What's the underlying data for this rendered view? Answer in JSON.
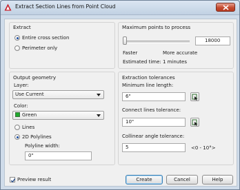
{
  "window": {
    "title": "Extract Section Lines from Point Cloud"
  },
  "extract": {
    "title": "Extract",
    "option_entire": "Entire cross section",
    "option_perimeter": "Perimeter only",
    "selected": "Entire cross section"
  },
  "max_points": {
    "title": "Maximum points to process",
    "value": "18000",
    "label_faster": "Faster",
    "label_accurate": "More accurate",
    "estimated": "Estimated time: 1 minutes",
    "slider_fraction": 0.0
  },
  "output": {
    "title": "Output geometry",
    "layer_label": "Layer:",
    "layer_value": "Use Current",
    "color_label": "Color:",
    "color_value": "Green",
    "color_swatch": "#1eaa2c",
    "option_lines": "Lines",
    "option_polylines": "2D Polylines",
    "selected": "2D Polylines",
    "polyline_width_label": "Polyline width:",
    "polyline_width_value": "0\""
  },
  "tolerances": {
    "title": "Extraction tolerances",
    "min_line_label": "Minimum line length:",
    "min_line_value": "6\"",
    "connect_label": "Connect lines tolerance:",
    "connect_value": "10\"",
    "collinear_label": "Collinear angle tolerance:",
    "collinear_value": "5",
    "collinear_range": "<0 - 10°>"
  },
  "footer": {
    "preview_label": "Preview result",
    "preview_checked": true,
    "create_label": "Create",
    "cancel_label": "Cancel",
    "help_label": "Help"
  }
}
